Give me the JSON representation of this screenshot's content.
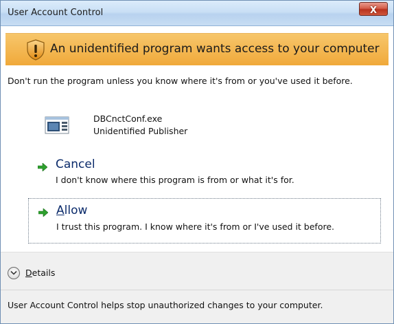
{
  "window": {
    "title": "User Account Control",
    "close_label": "X"
  },
  "banner": {
    "icon": "shield-warning-icon",
    "text": "An unidentified program wants access to your computer",
    "color": "#f0a93a"
  },
  "warning": {
    "text": "Don't run the program unless you know where it's from or you've used it before."
  },
  "program": {
    "icon": "program-icon",
    "name": "DBCnctConf.exe",
    "publisher": "Unidentified Publisher"
  },
  "options": [
    {
      "title": "Cancel",
      "description": "I don't know where this program is from or what it's for.",
      "icon": "green-arrow-icon"
    },
    {
      "title_prefix": "A",
      "title_rest": "llow",
      "description": "I trust this program. I know where it's from or I've used it before.",
      "icon": "green-arrow-icon",
      "focused": true
    }
  ],
  "details": {
    "label_prefix": "D",
    "label_rest": "etails",
    "icon": "chevron-down-icon"
  },
  "footer": {
    "text": "User Account Control helps stop unauthorized changes to your computer."
  }
}
